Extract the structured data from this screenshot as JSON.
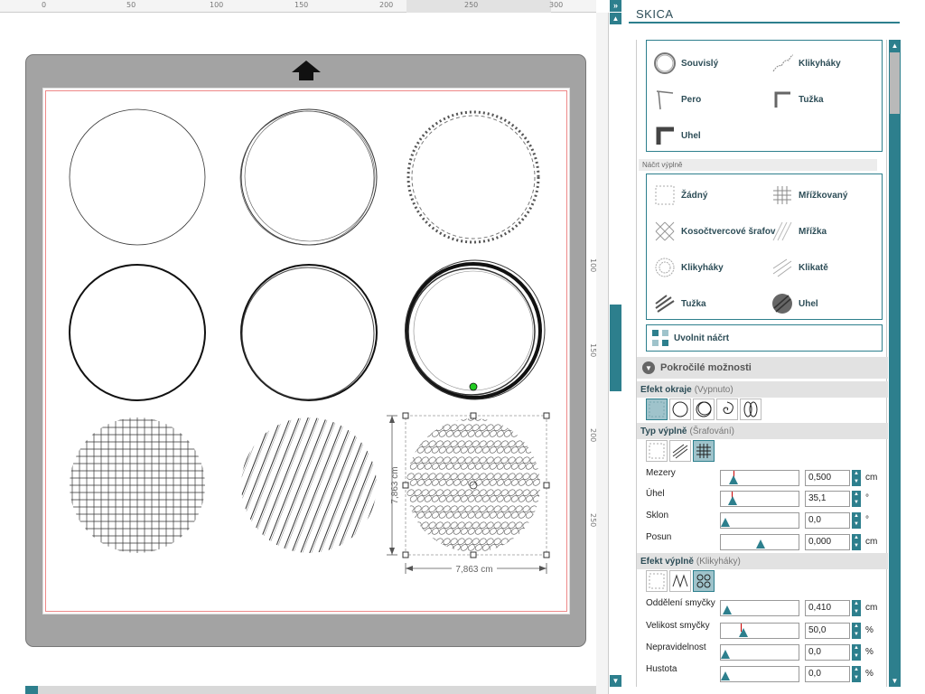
{
  "ruler": {
    "top_ticks": [
      "0",
      "50",
      "100",
      "150",
      "200",
      "250",
      "300"
    ],
    "left_ticks": [
      "100",
      "150",
      "200",
      "250"
    ]
  },
  "canvas": {
    "dim_width": "7,863 cm",
    "dim_height": "7,863 cm"
  },
  "panel": {
    "title": "SKICA",
    "outline_styles": [
      {
        "label": "Souvislý",
        "icon": "continuous-circle-icon"
      },
      {
        "label": "Klikyháky",
        "icon": "scribble-icon"
      },
      {
        "label": "Pero",
        "icon": "pen-icon"
      },
      {
        "label": "Tužka",
        "icon": "pencil-icon"
      },
      {
        "label": "Uhel",
        "icon": "charcoal-icon"
      }
    ],
    "fill_sketch_label": "Náčrt výplně",
    "fill_styles": [
      {
        "label": "Žádný",
        "icon": "none-fill-icon"
      },
      {
        "label": "Mřížkovaný",
        "icon": "grid-fill-icon"
      },
      {
        "label": "Kosočtvercové šrafov",
        "icon": "diamond-hatch-icon"
      },
      {
        "label": "Mřížka",
        "icon": "mesh-fill-icon"
      },
      {
        "label": "Klikyháky",
        "icon": "scribble-fill-icon"
      },
      {
        "label": "Klikatě",
        "icon": "zigzag-fill-icon"
      },
      {
        "label": "Tužka",
        "icon": "pencil-fill-icon"
      },
      {
        "label": "Uhel",
        "icon": "charcoal-fill-icon"
      }
    ],
    "release_label": "Uvolnit náčrt",
    "advanced_label": "Pokročilé možnosti",
    "edge_effect": {
      "label": "Efekt okraje",
      "state": "(Vypnuto)"
    },
    "fill_type": {
      "label": "Typ výplně",
      "state": "(Šrafování)"
    },
    "fill_params": [
      {
        "label": "Mezery",
        "value": "0,500",
        "unit": "cm",
        "level": 0.12
      },
      {
        "label": "Úhel",
        "value": "35,1",
        "unit": "°",
        "level": 0.1
      },
      {
        "label": "Sklon",
        "value": "0,0",
        "unit": "°",
        "level": 0.0
      },
      {
        "label": "Posun",
        "value": "0,000",
        "unit": "cm",
        "level": 0.5
      }
    ],
    "fill_effect": {
      "label": "Efekt výplně",
      "state": "(Klikyháky)"
    },
    "effect_params": [
      {
        "label": "Oddělení smyčky",
        "value": "0,410",
        "unit": "cm",
        "level": 0.03
      },
      {
        "label": "Velikost smyčky",
        "value": "50,0",
        "unit": "%",
        "level": 0.25
      },
      {
        "label": "Nepravidelnost",
        "value": "0,0",
        "unit": "%",
        "level": 0.0
      },
      {
        "label": "Hustota",
        "value": "0,0",
        "unit": "%",
        "level": 0.0
      }
    ]
  },
  "colors": {
    "accent": "#2d7f8d",
    "mat": "#a3a3a3",
    "handle_green": "#22cc22"
  }
}
